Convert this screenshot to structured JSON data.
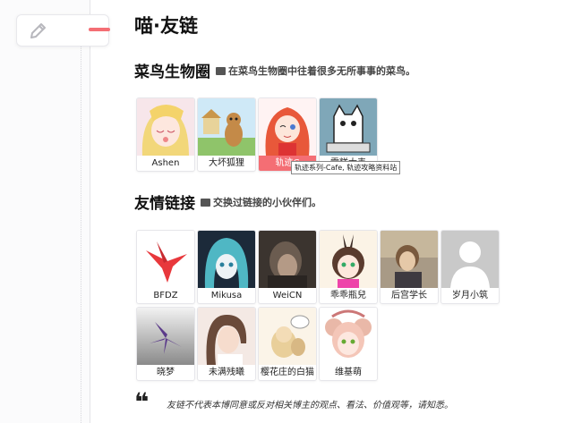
{
  "page_title": "喵·友链",
  "sidebar": {
    "edit_icon": "pencil-icon"
  },
  "section1": {
    "title": "菜鸟生物圈",
    "desc": "在菜鸟生物圈中往着很多无所事事的菜鸟。",
    "items": [
      {
        "name": "Ashen"
      },
      {
        "name": "大坏狐狸"
      },
      {
        "name": "轨迹C"
      },
      {
        "name": "雪糕大表"
      }
    ],
    "tooltip": "轨迹系列-Cafe, 轨迹攻略资料站"
  },
  "section2": {
    "title": "友情链接",
    "desc": "交换过链接的小伙伴们。",
    "items": [
      {
        "name": "BFDZ"
      },
      {
        "name": "Mikusa"
      },
      {
        "name": "WeiCN"
      },
      {
        "name": "乖乖瓶兒"
      },
      {
        "name": "后宫学长"
      },
      {
        "name": "岁月小筑"
      },
      {
        "name": "晓梦"
      },
      {
        "name": "未满残曦"
      },
      {
        "name": "樱花庄的白猫"
      },
      {
        "name": "维基萌"
      }
    ]
  },
  "disclaimer": "友链不代表本博同意或反对相关博主的观点、看法、价值观等，请知悉。",
  "colors": {
    "accent": "#f46e74"
  }
}
